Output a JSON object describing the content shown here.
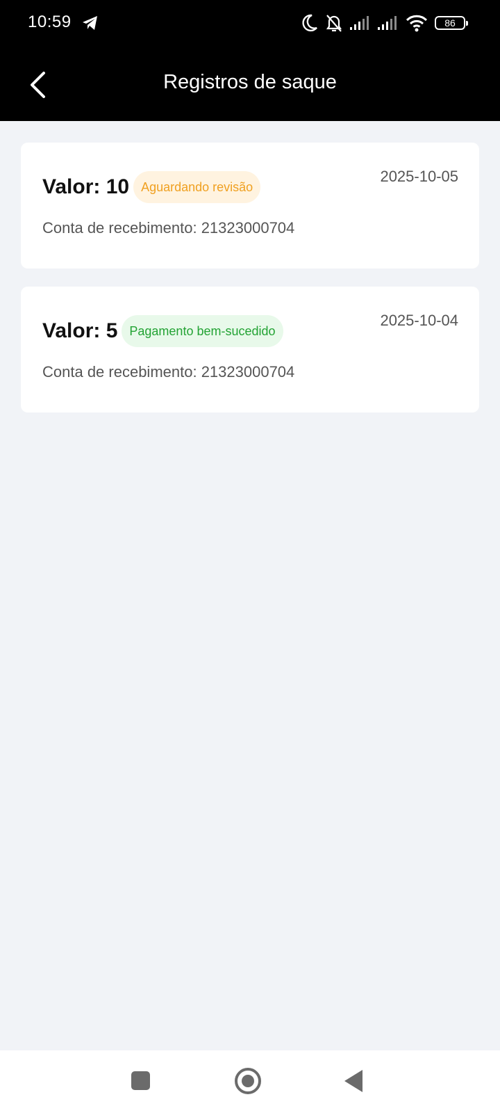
{
  "status_bar": {
    "time": "10:59",
    "battery": "86",
    "icons": [
      "telegram-icon",
      "moon-icon",
      "bell-off-icon",
      "signal-icon",
      "signal-icon",
      "wifi-icon",
      "battery-icon"
    ]
  },
  "header": {
    "title": "Registros de saque",
    "back_icon": "chevron-left-icon"
  },
  "records": [
    {
      "amount": "Valor: 10",
      "status": "Aguardando revisão",
      "status_color": "#f0a020",
      "date": "2025-10-05",
      "account": "Conta de recebimento: 21323000704"
    },
    {
      "amount": "Valor: 5",
      "status": "Pagamento bem-sucedido",
      "status_color": "#23a334",
      "date": "2025-10-04",
      "account": "Conta de recebimento: 21323000704"
    }
  ],
  "nav_bar": {
    "icons": [
      "recents-square-icon",
      "home-circle-icon",
      "back-triangle-icon"
    ]
  },
  "colors": {
    "header_bg": "#000000",
    "page_bg": "#f1f3f7",
    "card_bg": "#ffffff",
    "pending_badge_bg": "#fff3e0",
    "success_badge_bg": "#e8f9ea"
  }
}
